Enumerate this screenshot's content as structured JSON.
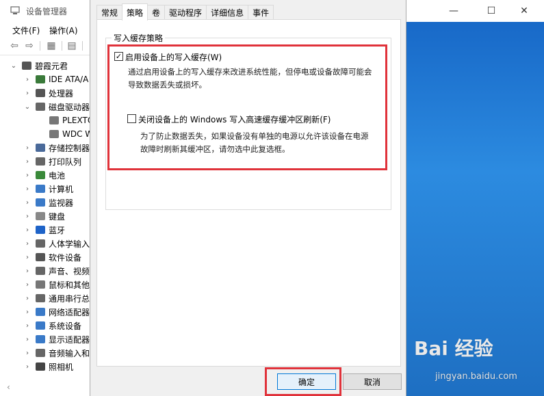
{
  "window": {
    "title": "设备管理器",
    "controls": {
      "minimize": "—",
      "maximize": "☐",
      "close": "✕"
    }
  },
  "menu": {
    "file": "文件(F)",
    "action": "操作(A)"
  },
  "tree": {
    "root": "碧霞元君",
    "items": [
      {
        "label": "IDE ATA/A",
        "arrow": "›",
        "color": "#3a7a3a"
      },
      {
        "label": "处理器",
        "arrow": "›",
        "color": "#555555"
      },
      {
        "label": "磁盘驱动器",
        "arrow": "⌄",
        "color": "#666666"
      },
      {
        "label": "PLEXTO",
        "arrow": "",
        "color": "#777777"
      },
      {
        "label": "WDC W",
        "arrow": "",
        "color": "#777777"
      },
      {
        "label": "存储控制器",
        "arrow": "›",
        "color": "#4a6a9a"
      },
      {
        "label": "打印队列",
        "arrow": "›",
        "color": "#666666"
      },
      {
        "label": "电池",
        "arrow": "›",
        "color": "#3a8a3a"
      },
      {
        "label": "计算机",
        "arrow": "›",
        "color": "#3a7ac8"
      },
      {
        "label": "监视器",
        "arrow": "›",
        "color": "#3a7ac8"
      },
      {
        "label": "键盘",
        "arrow": "›",
        "color": "#888888"
      },
      {
        "label": "蓝牙",
        "arrow": "›",
        "color": "#1e63c8"
      },
      {
        "label": "人体学输入",
        "arrow": "›",
        "color": "#666666"
      },
      {
        "label": "软件设备",
        "arrow": "›",
        "color": "#555555"
      },
      {
        "label": "声音、视频",
        "arrow": "›",
        "color": "#666666"
      },
      {
        "label": "鼠标和其他",
        "arrow": "›",
        "color": "#777777"
      },
      {
        "label": "通用串行总",
        "arrow": "›",
        "color": "#666666"
      },
      {
        "label": "网络适配器",
        "arrow": "›",
        "color": "#3a7ac8"
      },
      {
        "label": "系统设备",
        "arrow": "›",
        "color": "#3a7ac8"
      },
      {
        "label": "显示适配器",
        "arrow": "›",
        "color": "#3a7ac8"
      },
      {
        "label": "音频输入和",
        "arrow": "›",
        "color": "#666666"
      },
      {
        "label": "照相机",
        "arrow": "›",
        "color": "#444444"
      }
    ]
  },
  "dialog": {
    "tabs": [
      "常规",
      "策略",
      "卷",
      "驱动程序",
      "详细信息",
      "事件"
    ],
    "active_tab": "策略",
    "group_title": "写入缓存策略",
    "option1": {
      "checked": true,
      "label": "启用设备上的写入缓存(W)",
      "desc_line1": "通过启用设备上的写入缓存来改进系统性能，但停电或设备故障可能会",
      "desc_line2": "导致数据丢失或损坏。"
    },
    "option2": {
      "checked": false,
      "label": "关闭设备上的 Windows 写入高速缓存缓冲区刷新(F)",
      "desc_line1": "为了防止数据丢失，如果设备没有单独的电源以允许该设备在电源",
      "desc_line2": "故障时刷新其缓冲区，请勿选中此复选框。"
    },
    "ok_label": "确定",
    "cancel_label": "取消"
  },
  "watermark": {
    "brand": "Bai 经验",
    "url": "jingyan.baidu.com"
  },
  "colors": {
    "highlight": "#e0323a",
    "accent": "#0078d7"
  }
}
